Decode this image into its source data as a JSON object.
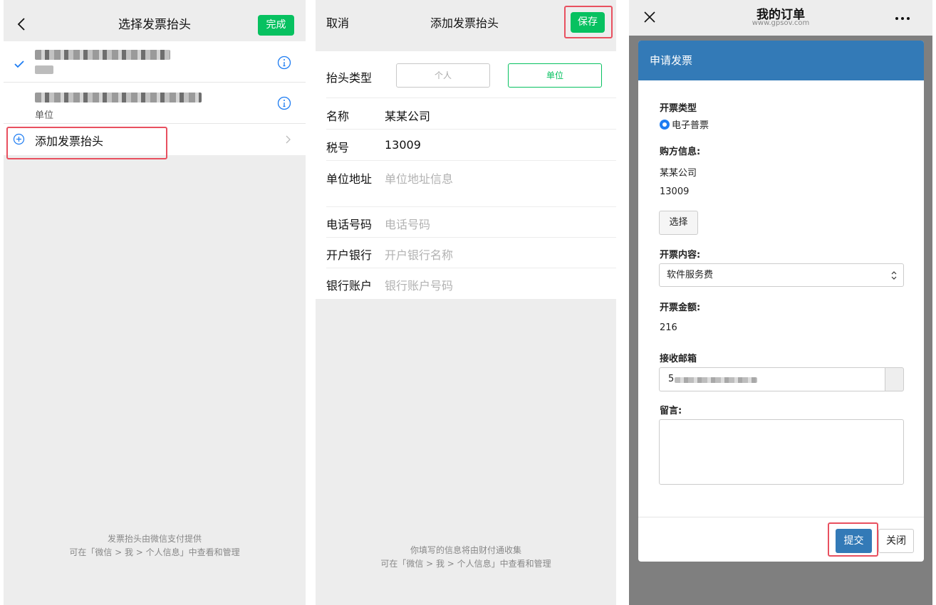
{
  "panel1": {
    "title": "选择发票抬头",
    "done_label": "完成",
    "items": [
      {
        "sub": ""
      },
      {
        "sub": "单位"
      }
    ],
    "add_label": "添加发票抬头",
    "footer_line1": "发票抬头由微信支付提供",
    "footer_line2": "可在「微信 > 我 > 个人信息」中查看和管理"
  },
  "panel2": {
    "cancel_label": "取消",
    "title": "添加发票抬头",
    "save_label": "保存",
    "type_label": "抬头类型",
    "type_personal": "个人",
    "type_company": "单位",
    "name_label": "名称",
    "name_value": "某某公司",
    "tax_label": "税号",
    "tax_value": "13009",
    "address_label": "单位地址",
    "address_placeholder": "单位地址信息",
    "phone_label": "电话号码",
    "phone_placeholder": "电话号码",
    "bank_label": "开户银行",
    "bank_placeholder": "开户银行名称",
    "account_label": "银行账户",
    "account_placeholder": "银行账户号码",
    "footer_line1": "你填写的信息将由财付通收集",
    "footer_line2": "可在「微信 > 我 > 个人信息」中查看和管理"
  },
  "panel3": {
    "title": "我的订单",
    "subtitle": "www.gpsov.com",
    "modal_title": "申请发票",
    "invoice_type_label": "开票类型",
    "invoice_type_value": "电子普票",
    "buyer_label": "购方信息:",
    "buyer_name": "某某公司",
    "buyer_tax": "13009",
    "choose_label": "选择",
    "content_label": "开票内容:",
    "content_value": "软件服务费",
    "amount_label": "开票金额:",
    "amount_value": "216",
    "email_label": "接收邮箱",
    "email_value_prefix": "5",
    "note_label": "留言:",
    "submit_label": "提交",
    "close_label": "关闭"
  },
  "colors": {
    "wechat_green": "#07c160",
    "highlight_red": "#e8505f",
    "modal_blue": "#337ab7",
    "info_blue": "#1d7cf2"
  }
}
